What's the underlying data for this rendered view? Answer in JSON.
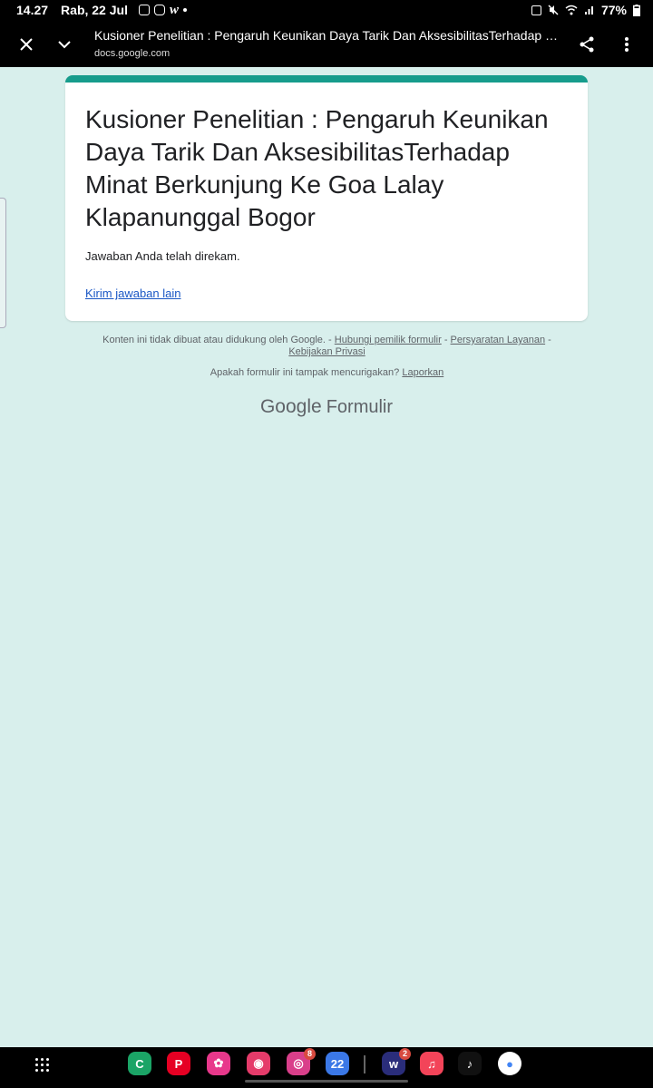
{
  "status": {
    "time": "14.27",
    "date": "Rab, 22 Jul",
    "notif_app": "w",
    "battery": "77%"
  },
  "toolbar": {
    "title": "Kusioner Penelitian : Pengaruh Keunikan Daya Tarik Dan AksesibilitasTerhadap Minat ...",
    "url": "docs.google.com"
  },
  "form": {
    "title": "Kusioner Penelitian : Pengaruh Keunikan Daya Tarik Dan AksesibilitasTerhadap Minat Berkunjung Ke Goa Lalay Klapanunggal Bogor",
    "message": "Jawaban Anda telah direkam.",
    "send_another": "Kirim jawaban lain"
  },
  "footer": {
    "disclaimer": "Konten ini tidak dibuat atau didukung oleh Google.",
    "sep": " - ",
    "contact": "Hubungi pemilik formulir",
    "terms": "Persyaratan Layanan",
    "privacy": "Kebijakan Privasi",
    "suspicious": "Apakah formulir ini tampak mencurigakan?",
    "report": "Laporkan",
    "brand_google": "Google",
    "brand_forms": "Formulir"
  },
  "dock": {
    "apps": [
      {
        "name": "phone",
        "label": "C",
        "color": "#1ba466"
      },
      {
        "name": "pinterest",
        "label": "P",
        "color": "#e60023"
      },
      {
        "name": "blossom",
        "label": "✿",
        "color": "#e8388b"
      },
      {
        "name": "camera",
        "label": "◉",
        "color": "#e53b6a"
      },
      {
        "name": "instagram",
        "label": "◎",
        "color": "#d93f8a",
        "badge": "8"
      },
      {
        "name": "calendar",
        "label": "22",
        "color": "#3b78e7"
      },
      {
        "name": "wattpad",
        "label": "w",
        "color": "#2a2d7a",
        "badge": "2"
      },
      {
        "name": "music",
        "label": "♫",
        "color": "#f34459"
      },
      {
        "name": "tiktok",
        "label": "♪",
        "color": "#111111"
      },
      {
        "name": "chrome",
        "label": "●",
        "color": "#ffffff"
      }
    ]
  }
}
